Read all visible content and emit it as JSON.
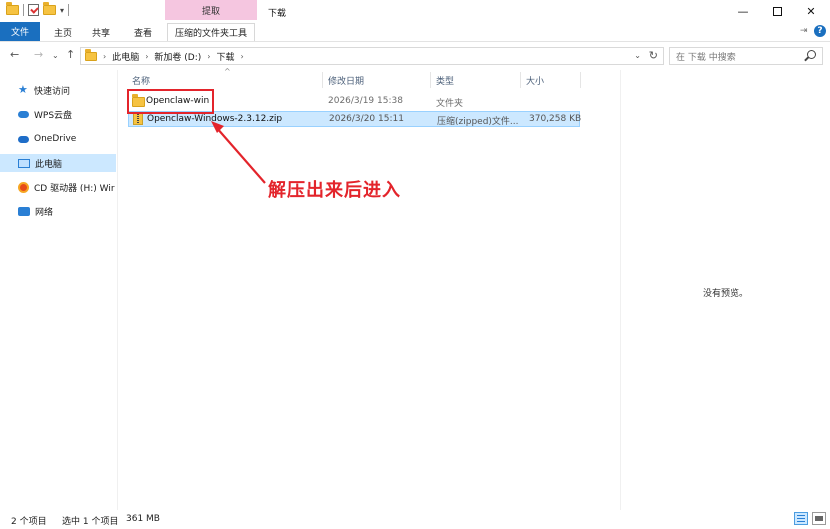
{
  "titlebar": {
    "context_tab_head": "提取",
    "window_title": "下载",
    "minimize": "—",
    "close": "✕"
  },
  "ribbon": {
    "tabs": [
      "文件",
      "主页",
      "共享",
      "查看",
      "压缩的文件夹工具"
    ],
    "help": "?"
  },
  "navigation": {
    "back": "←",
    "forward": "→",
    "recent": "⌄",
    "up": "↑",
    "breadcrumbs": [
      "此电脑",
      "新加卷 (D:)",
      "下载"
    ],
    "refresh": "↻",
    "search_placeholder": "在 下载 中搜索"
  },
  "sidebar": {
    "items": [
      {
        "label": "快速访问",
        "icon": "star-icon"
      },
      {
        "label": "WPS云盘",
        "icon": "cloud-icon"
      },
      {
        "label": "OneDrive",
        "icon": "onedrive-icon"
      },
      {
        "label": "此电脑",
        "icon": "computer-icon",
        "selected": true
      },
      {
        "label": "CD 驱动器 (H:) Wir",
        "icon": "cd-drive-icon"
      },
      {
        "label": "网络",
        "icon": "network-icon"
      }
    ]
  },
  "file_list": {
    "columns": [
      "名称",
      "修改日期",
      "类型",
      "大小"
    ],
    "rows": [
      {
        "name": "Openclaw-win",
        "date": "2026/3/19 15:38",
        "type": "文件夹",
        "size": "",
        "icon": "folder-icon"
      },
      {
        "name": "Openclaw-Windows-2.3.12.zip",
        "date": "2026/3/20 15:11",
        "type": "压缩(zipped)文件...",
        "size": "370,258 KB",
        "icon": "zip-icon",
        "selected": true
      }
    ]
  },
  "annotation": {
    "text": "解压出来后进入",
    "color": "#e3242b"
  },
  "preview": {
    "text": "没有预览。"
  },
  "status_bar": {
    "item_count": "2 个项目",
    "selected": "选中 1 个项目",
    "size": "361 MB"
  },
  "colors": {
    "accent": "#1a6fbf",
    "selection": "#cce8ff",
    "context_tab": "#f5c6e0"
  }
}
